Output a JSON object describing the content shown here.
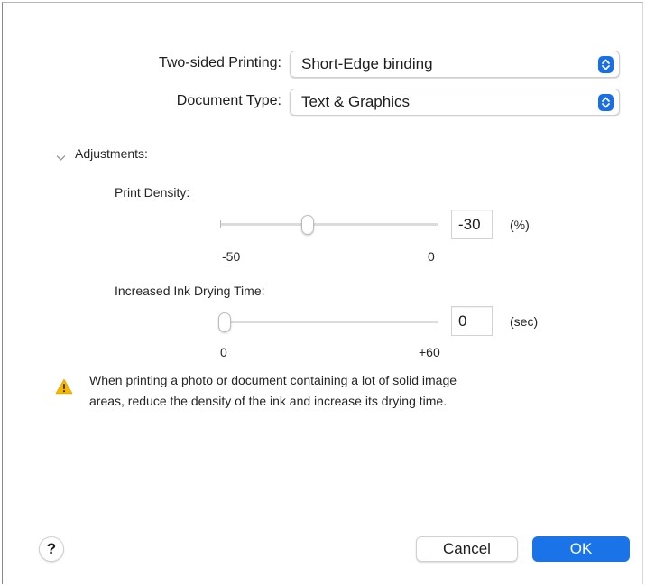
{
  "dialog": {
    "two_sided": {
      "label": "Two-sided Printing:",
      "value": "Short-Edge binding"
    },
    "document_type": {
      "label": "Document Type:",
      "value": "Text & Graphics"
    },
    "adjustments": {
      "label": "Adjustments:",
      "print_density": {
        "label": "Print Density:",
        "value": "-30",
        "unit": "(%)",
        "min_label": "-50",
        "max_label": "0",
        "range": [
          -50,
          0
        ],
        "current": -30
      },
      "drying_time": {
        "label": "Increased Ink Drying Time:",
        "value": "0",
        "unit": "(sec)",
        "min_label": "0",
        "max_label": "+60",
        "range": [
          0,
          60
        ],
        "current": 0
      }
    },
    "warning": {
      "icon": "warning-triangle-icon",
      "line1": "When printing a photo or document containing a lot of solid image",
      "line2": "areas, reduce the density of the ink and increase its drying time."
    },
    "buttons": {
      "help": "?",
      "cancel": "Cancel",
      "ok": "OK"
    }
  },
  "colors": {
    "accent": "#1a74e8",
    "warning": "#f5b800"
  }
}
